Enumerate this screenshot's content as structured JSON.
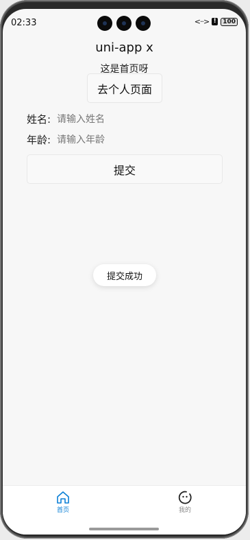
{
  "status_bar": {
    "time": "02:33",
    "battery": "100"
  },
  "app": {
    "title": "uni-app x"
  },
  "home": {
    "page_text": "这是首页呀",
    "personal_button": "去个人页面"
  },
  "form": {
    "name_label": "姓名:",
    "name_placeholder": "请输入姓名",
    "age_label": "年龄:",
    "age_placeholder": "请输入年龄",
    "submit_label": "提交"
  },
  "toast": {
    "message": "提交成功"
  },
  "tabbar": {
    "active_color": "#0a7fd6",
    "inactive_color": "#8a8a8a",
    "items": [
      {
        "label": "首页",
        "icon": "home-icon"
      },
      {
        "label": "我的",
        "icon": "profile-icon"
      }
    ]
  }
}
